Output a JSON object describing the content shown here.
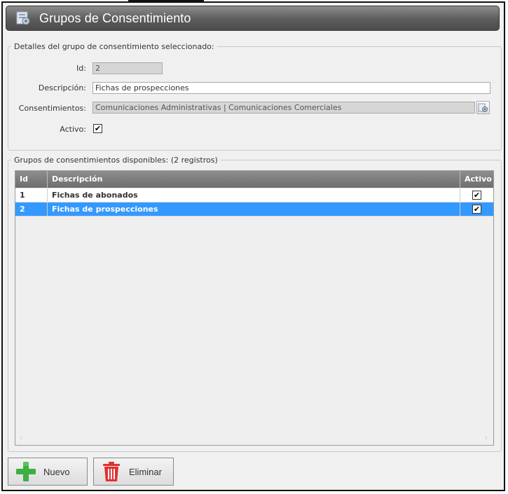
{
  "window": {
    "title": "Grupos de Consentimiento"
  },
  "details": {
    "legend": "Detalles del grupo de consentimiento seleccionado:",
    "id_label": "Id:",
    "id_value": "2",
    "descripcion_label": "Descripción:",
    "descripcion_value": "Fichas de prospecciones",
    "consentimientos_label": "Consentimientos:",
    "consentimientos_value": "Comunicaciones Administrativas | Comunicaciones Comerciales",
    "activo_label": "Activo:",
    "activo_checked": true
  },
  "grid": {
    "legend": "Grupos de consentimientos disponibles:  (2 registros)",
    "columns": {
      "id": "Id",
      "descripcion": "Descripción",
      "activo": "Activo"
    },
    "rows": [
      {
        "id": "1",
        "descripcion": "Fichas de abonados",
        "activo": true,
        "selected": false
      },
      {
        "id": "2",
        "descripcion": "Fichas de prospecciones",
        "activo": true,
        "selected": true
      }
    ]
  },
  "toolbar": {
    "nuevo_label": "Nuevo",
    "eliminar_label": "Eliminar"
  },
  "colors": {
    "selection": "#3399ff",
    "header": "#7a7a7a",
    "add": "#3cb043",
    "delete": "#e03030"
  },
  "icons": {
    "title": "consent-group-icon",
    "picker": "gear-picker-icon",
    "nuevo": "plus-icon",
    "eliminar": "trash-icon"
  }
}
